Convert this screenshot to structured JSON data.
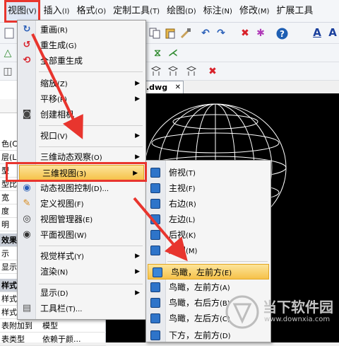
{
  "menubar": {
    "items": [
      {
        "label": "视图",
        "key": "(V)"
      },
      {
        "label": "插入",
        "key": "(I)"
      },
      {
        "label": "格式",
        "key": "(O)"
      },
      {
        "label": "定制工具",
        "key": "(T)"
      },
      {
        "label": "绘图",
        "key": "(D)"
      },
      {
        "label": "标注",
        "key": "(N)"
      },
      {
        "label": "修改",
        "key": "(M)"
      },
      {
        "label": "扩展工具",
        "key": ""
      }
    ]
  },
  "document": {
    "tab": ".dwg"
  },
  "left_panel": {
    "rows": [
      "色(C)",
      "层(L)",
      "型",
      "型比例",
      "宽",
      "度",
      "明",
      "效果",
      "示",
      "显示",
      "样式",
      "样式",
      "样式",
      "表附加到",
      "表类型"
    ],
    "row_right": [
      "",
      "",
      "",
      "",
      "",
      "",
      "",
      "",
      "",
      "",
      "",
      "",
      "",
      "模型",
      "依赖于颜..."
    ]
  },
  "view_menu": {
    "items": [
      {
        "label": "重画",
        "key": "(R)",
        "icon": "redraw-icon"
      },
      {
        "label": "重生成",
        "key": "(G)",
        "icon": "regen-icon"
      },
      {
        "label": "全部重生成",
        "key": "",
        "icon": "regen-all-icon"
      },
      {
        "label": "缩放",
        "key": "(Z)",
        "submenu": true
      },
      {
        "label": "平移",
        "key": "(P)",
        "submenu": true
      },
      {
        "label": "创建相机",
        "key": "",
        "icon": "camera-icon"
      },
      {
        "label": "视口",
        "key": "(V)",
        "submenu": true
      },
      {
        "label": "三维动态观察",
        "key": "(O)",
        "submenu": true
      },
      {
        "label": "三维视图",
        "key": "(3)",
        "submenu": true
      },
      {
        "label": "动态视图控制",
        "key": "(D)...",
        "icon": "dynamic-view-icon"
      },
      {
        "label": "定义视图",
        "key": "(F)",
        "icon": "define-view-icon"
      },
      {
        "label": "视图管理器",
        "key": "(E)",
        "icon": "eye-icon"
      },
      {
        "label": "平面视图",
        "key": "(W)",
        "icon": "plan-view-icon"
      },
      {
        "label": "视觉样式",
        "key": "(Y)",
        "submenu": true
      },
      {
        "label": "渲染",
        "key": "(N)",
        "submenu": true
      },
      {
        "label": "显示",
        "key": "(D)",
        "submenu": true
      },
      {
        "label": "工具栏",
        "key": "(T)...",
        "icon": "toolbar-icon"
      }
    ]
  },
  "view3d_menu": {
    "items": [
      {
        "label": "俯视",
        "key": "(T)"
      },
      {
        "label": "主视",
        "key": "(F)"
      },
      {
        "label": "右边",
        "key": "(R)"
      },
      {
        "label": "左边",
        "key": "(L)"
      },
      {
        "label": "后视",
        "key": "(K)"
      },
      {
        "label": "底视",
        "key": "(M)"
      },
      {
        "label": "鸟瞰，左前方",
        "key": "(E)"
      },
      {
        "label": "鸟瞰，左前方",
        "key": "(A)"
      },
      {
        "label": "鸟瞰，右后方",
        "key": "(B)"
      },
      {
        "label": "鸟瞰，左后方",
        "key": "(C)"
      },
      {
        "label": "下方，左前方",
        "key": "(D)"
      }
    ]
  },
  "watermark": {
    "name": "当下软件园",
    "url": "www.downxia.com"
  },
  "colors": {
    "annotation_red": "#e8352e",
    "highlight": "#f6c24a",
    "cube_blue": "#2e74c9"
  }
}
